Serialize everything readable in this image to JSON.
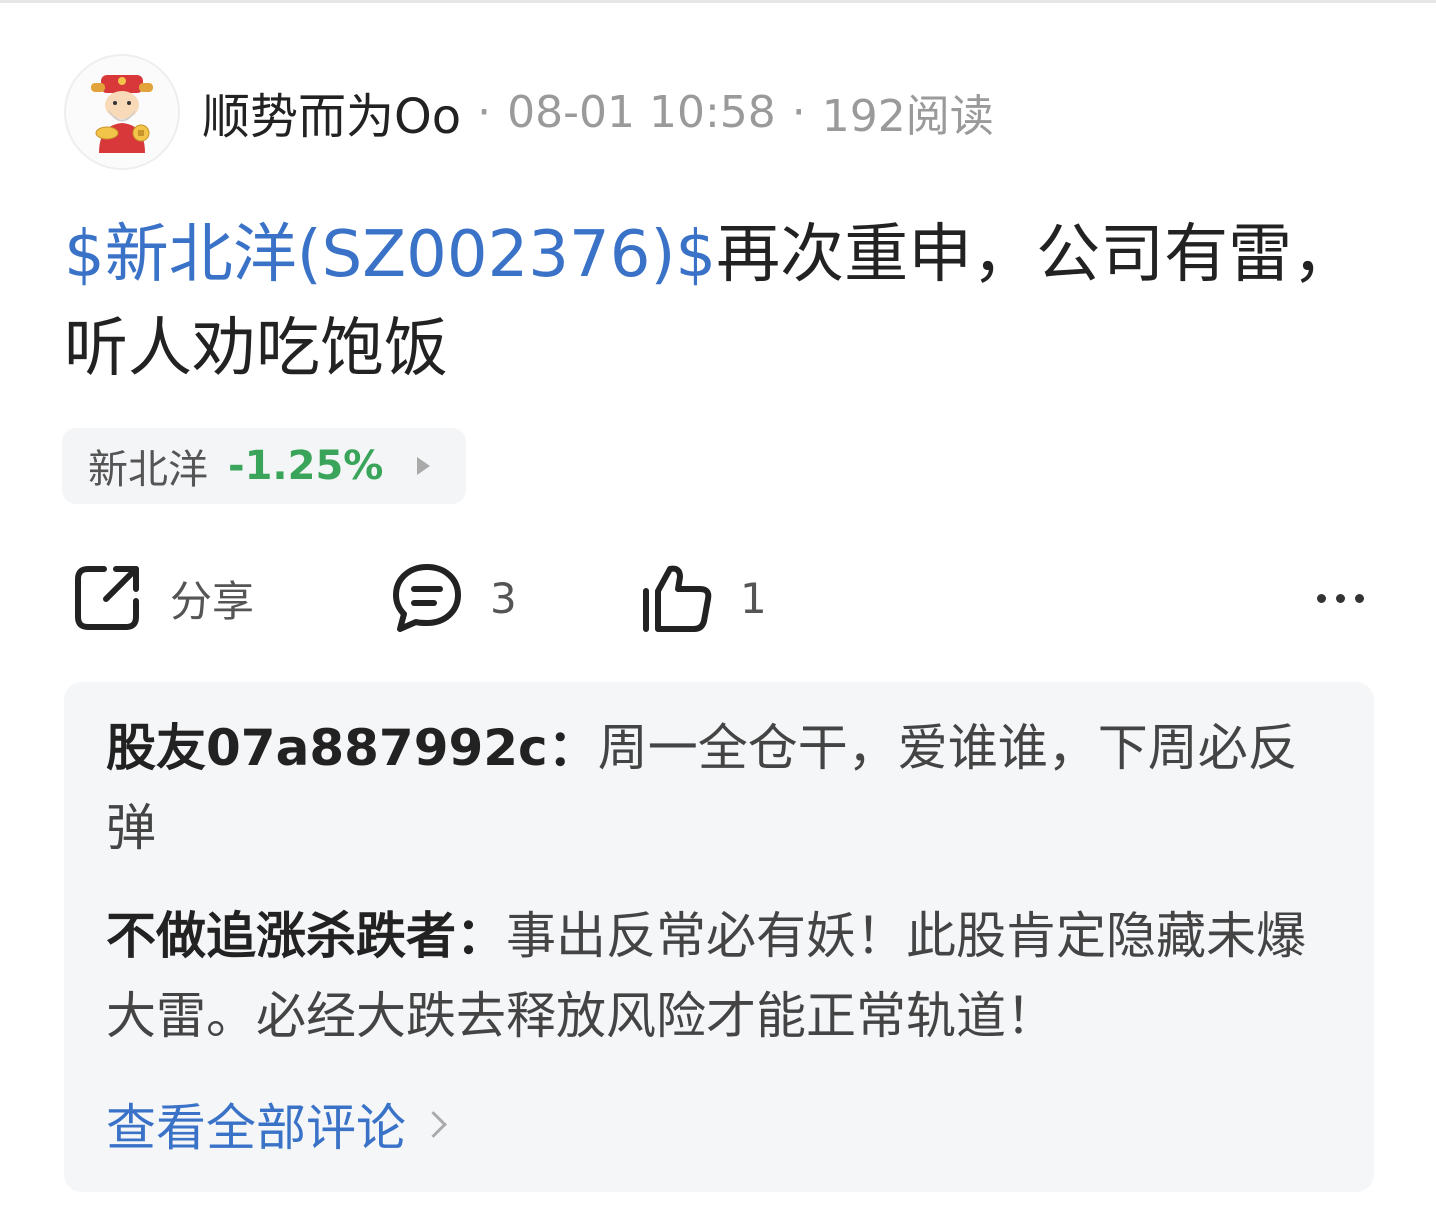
{
  "header": {
    "author": "顺势而为Oo",
    "separator": "·",
    "time": "08-01 10:58",
    "reads": "192阅读"
  },
  "post": {
    "stock_tag": "$新北洋(SZ002376)$",
    "text": "再次重申，公司有雷，听人劝吃饱饭"
  },
  "stock_chip": {
    "name": "新北洋",
    "change": "-1.25%",
    "change_color": "#3aa55a"
  },
  "actions": {
    "share_label": "分享",
    "comment_count": "3",
    "like_count": "1"
  },
  "comments": [
    {
      "user": "股友07a887992c：",
      "text": "周一全仓干，爱谁谁，下周必反弹"
    },
    {
      "user": "不做追涨杀跌者：",
      "text": "事出反常必有妖！此股肯定隐藏未爆大雷。必经大跌去释放风险才能正常轨道！"
    }
  ],
  "view_all_label": "查看全部评论",
  "colors": {
    "link_blue": "#3a72c8",
    "muted_gray": "#9a9a9a",
    "panel_bg": "#f5f6f8"
  },
  "icons": [
    "share-icon",
    "comment-icon",
    "like-icon",
    "more-icon",
    "chevron-right-icon",
    "avatar-god-of-wealth"
  ]
}
